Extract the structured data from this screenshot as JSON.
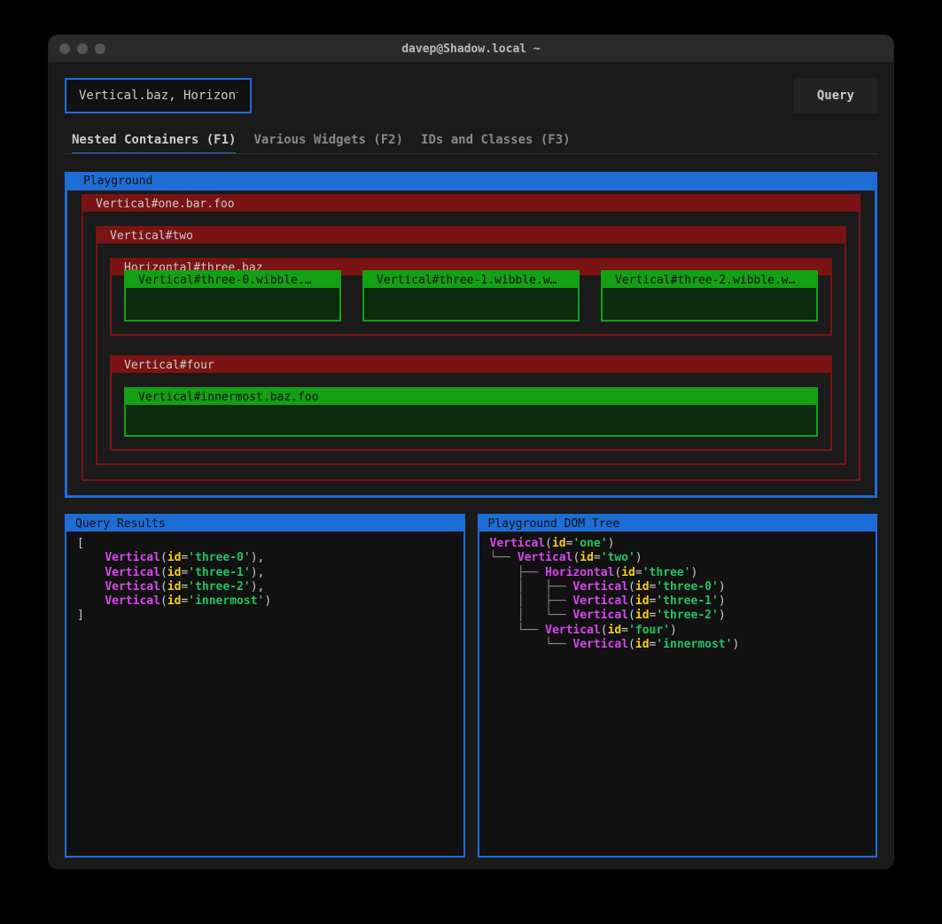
{
  "window": {
    "title": "davep@Shadow.local ~"
  },
  "query_input": {
    "value": "Vertical.baz, Horizontal > *"
  },
  "query_button": "Query",
  "tabs": [
    {
      "label": "Nested Containers (F1)",
      "active": true
    },
    {
      "label": "Various Widgets (F2)",
      "active": false
    },
    {
      "label": "IDs and Classes (F3)",
      "active": false
    }
  ],
  "playground": {
    "title": "Playground",
    "v1": "Vertical#one.bar.foo",
    "v2": "Vertical#two",
    "h3": "Horizontal#three.baz",
    "three_children": [
      "Vertical#three-0.wibble.…",
      "Vertical#three-1.wibble.w…",
      "Vertical#three-2.wibble.w…"
    ],
    "v4": "Vertical#four",
    "innermost": "Vertical#innermost.baz.foo"
  },
  "results": {
    "title": "Query Results",
    "items": [
      {
        "type": "Vertical",
        "id": "three-0",
        "trailing": ","
      },
      {
        "type": "Vertical",
        "id": "three-1",
        "trailing": ","
      },
      {
        "type": "Vertical",
        "id": "three-2",
        "trailing": ","
      },
      {
        "type": "Vertical",
        "id": "innermost",
        "trailing": ""
      }
    ]
  },
  "domtree": {
    "title": "Playground DOM Tree",
    "lines": [
      {
        "prefix": "",
        "type": "Vertical",
        "id": "one"
      },
      {
        "prefix": "└── ",
        "type": "Vertical",
        "id": "two"
      },
      {
        "prefix": "    ├── ",
        "type": "Horizontal",
        "id": "three"
      },
      {
        "prefix": "    │   ├── ",
        "type": "Vertical",
        "id": "three-0"
      },
      {
        "prefix": "    │   ├── ",
        "type": "Vertical",
        "id": "three-1"
      },
      {
        "prefix": "    │   └── ",
        "type": "Vertical",
        "id": "three-2"
      },
      {
        "prefix": "    └── ",
        "type": "Vertical",
        "id": "four"
      },
      {
        "prefix": "        └── ",
        "type": "Vertical",
        "id": "innermost"
      }
    ]
  }
}
